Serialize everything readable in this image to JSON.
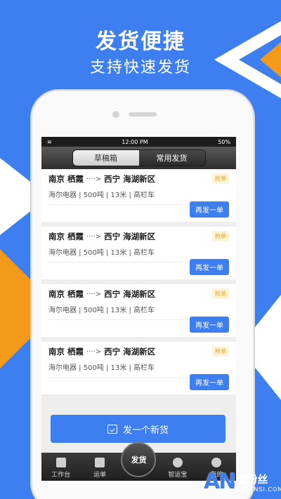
{
  "promo": {
    "headline": "发货便捷",
    "subline": "支持快速发货"
  },
  "statusbar": {
    "time": "12:00 PM",
    "battery": "50%"
  },
  "segments": {
    "drafts": "草稿箱",
    "frequent": "常用发货"
  },
  "orders": [
    {
      "origin": "南京 栖霞",
      "arrow": "····>",
      "destination": "西宁 海湖新区",
      "detail": "海尔电器 | 500吨 | 13米 | 高栏车",
      "badge": "抢单",
      "action": "再发一单"
    },
    {
      "origin": "南京 栖霞",
      "arrow": "····>",
      "destination": "西宁 海湖新区",
      "detail": "海尔电器 | 500吨 | 13米 | 高栏车",
      "badge": "抢单",
      "action": "再发一单"
    },
    {
      "origin": "南京 栖霞",
      "arrow": "····>",
      "destination": "西宁 海湖新区",
      "detail": "海尔电器 | 500吨 | 13米 | 高栏车",
      "badge": "抢单",
      "action": "再发一单"
    },
    {
      "origin": "南京 栖霞",
      "arrow": "····>",
      "destination": "西宁 海湖新区",
      "detail": "海尔电器 | 500吨 | 13米 | 高栏车",
      "badge": "抢单",
      "action": "再发一单"
    }
  ],
  "new_shipment": "发一个新货",
  "tabbar": {
    "workbench": "工作台",
    "waybill": "运单",
    "ship": "发货",
    "smart": "智运宝",
    "mine": "我的"
  },
  "watermark": {
    "logo": "AN",
    "cn": "安粉丝",
    "en": "ANFENSI.COM"
  },
  "colors": {
    "brand_blue": "#3d7ef0",
    "accent_orange": "#f39a1b"
  }
}
